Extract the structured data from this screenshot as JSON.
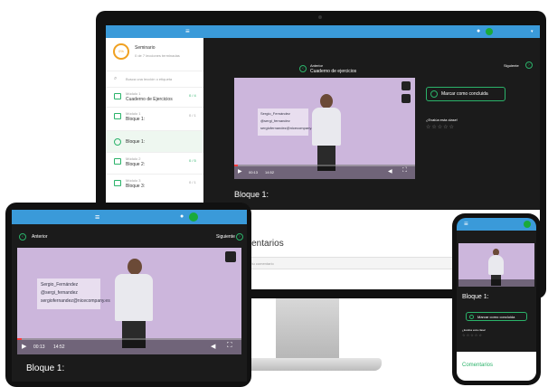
{
  "monitor": {
    "sidebar": {
      "course_title": "Seminario",
      "course_progress": "0 de 7 lecciones terminadas",
      "progress_ring_label": "0%",
      "search_placeholder": "Busca una lección o etiqueta",
      "items": [
        {
          "kind": "Módulo 1",
          "title": "Cuaderno de Ejercicios",
          "count": "0 / 4"
        },
        {
          "kind": "Módulo 1",
          "title": "Bloque 1:",
          "count": "0 / 1"
        },
        {
          "kind": "",
          "title": "Bloque 1:",
          "count": ""
        },
        {
          "kind": "Módulo 2",
          "title": "Bloque 2:",
          "count": "0 / 5"
        },
        {
          "kind": "Módulo 3",
          "title": "Bloque 3:",
          "count": "0 / 1"
        }
      ]
    },
    "nav": {
      "prev_label": "Anterior",
      "prev_title": "Cuaderno de ejercicios",
      "next_label": "Siguiente"
    },
    "video": {
      "slide_lines": [
        "Sergio_Fernández",
        "@sergi_fernandez",
        "sergiofernandez@nicecompany.es"
      ],
      "time": "00:13",
      "duration": "14:52",
      "progress": 0.02
    },
    "lesson_title": "Bloque 1:",
    "mark_complete": "Marcar como concluida",
    "rating_question": "¿Evalúa esta clase!",
    "stars": "☆☆☆☆☆",
    "comments_title": "Comentarios",
    "comment_placeholder": "Escribe tu comentario"
  },
  "tablet": {
    "nav": {
      "prev_label": "Anterior",
      "next_label": "Siguiente"
    },
    "video": {
      "slide_lines": [
        "Sergio_Fernández",
        "@sergi_fernandez",
        "sergiofernandez@nicecompany.es"
      ],
      "time": "00:13",
      "duration": "14:52",
      "progress": 0.02
    },
    "lesson_title": "Bloque 1:"
  },
  "phone": {
    "lesson_title": "Bloque 1:",
    "mark_complete": "Marcar como concluida",
    "rating_question": "¿Evalúa esta clase!",
    "stars": "☆☆☆☆☆",
    "comments_title": "Comentarios"
  },
  "colors": {
    "topbar": "#3a9ad9",
    "accent": "#2bb36a",
    "status": "#1aaa3a",
    "progress_ring": "#f0a020",
    "video_bg": "#ccb6dc",
    "dark_bg": "#1b1b1b"
  }
}
